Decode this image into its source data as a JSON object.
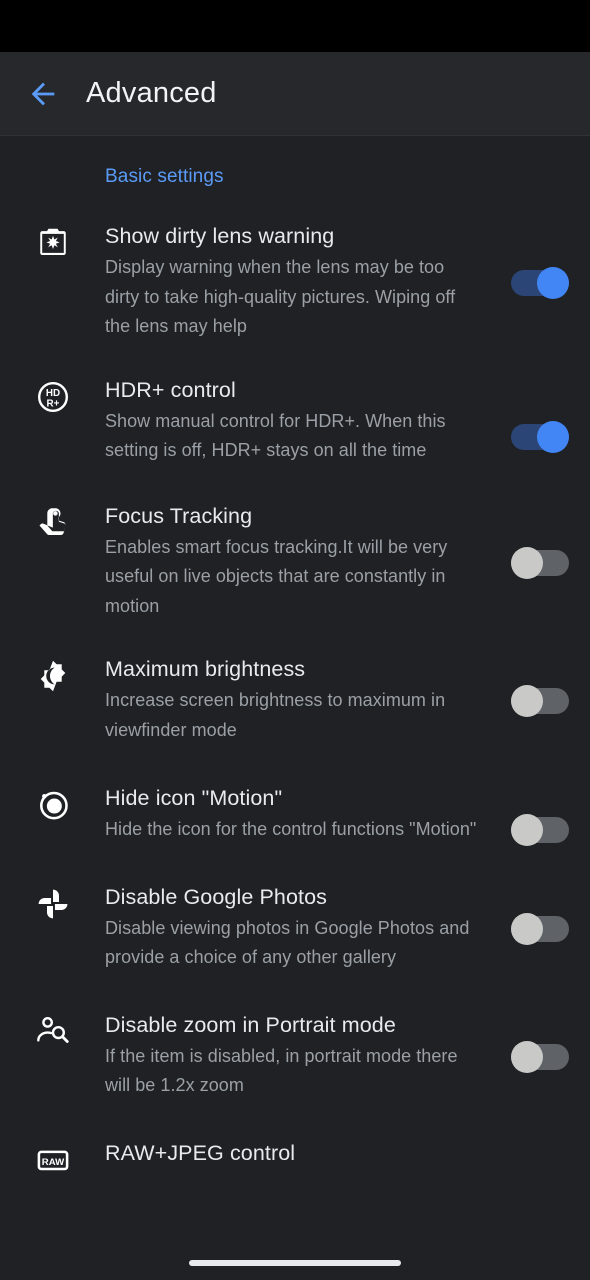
{
  "app": {
    "title": "Advanced",
    "back_icon": "arrow-left-icon",
    "accent_color": "#5b9bf8",
    "toggle_on_color": "#4285f4",
    "toggle_off_color": "#c9c9c7",
    "background_color": "#1f2124",
    "appbar_color": "#26282b"
  },
  "sections": [
    {
      "label": "Basic settings"
    }
  ],
  "settings": [
    {
      "icon": "dirty-lens-icon",
      "title": "Show dirty lens warning",
      "description": "Display warning when the lens may be too dirty to take high-quality pictures. Wiping off the lens may help",
      "toggle": "on"
    },
    {
      "icon": "hdr-plus-icon",
      "title": "HDR+ control",
      "description": "Show manual control for HDR+. When this setting is off, HDR+ stays on all the time",
      "toggle": "on"
    },
    {
      "icon": "touch-focus-icon",
      "title": "Focus Tracking",
      "description": "Enables smart focus tracking.It will be very useful on live objects that are constantly in motion",
      "toggle": "off"
    },
    {
      "icon": "brightness-icon",
      "title": "Maximum brightness",
      "description": "Increase screen brightness to maximum in viewfinder mode",
      "toggle": "off"
    },
    {
      "icon": "motion-icon",
      "title": "Hide icon \"Motion\"",
      "description": "Hide the icon for the control functions \"Motion\"",
      "toggle": "off"
    },
    {
      "icon": "google-photos-icon",
      "title": "Disable Google Photos",
      "description": "Disable viewing photos in Google Photos and provide a choice of any other gallery",
      "toggle": "off"
    },
    {
      "icon": "person-zoom-icon",
      "title": "Disable zoom in Portrait mode",
      "description": "If the item is disabled, in portrait mode there will be 1.2x zoom",
      "toggle": "off"
    },
    {
      "icon": "raw-icon",
      "title": "RAW+JPEG control",
      "description": "",
      "toggle": "none"
    }
  ]
}
